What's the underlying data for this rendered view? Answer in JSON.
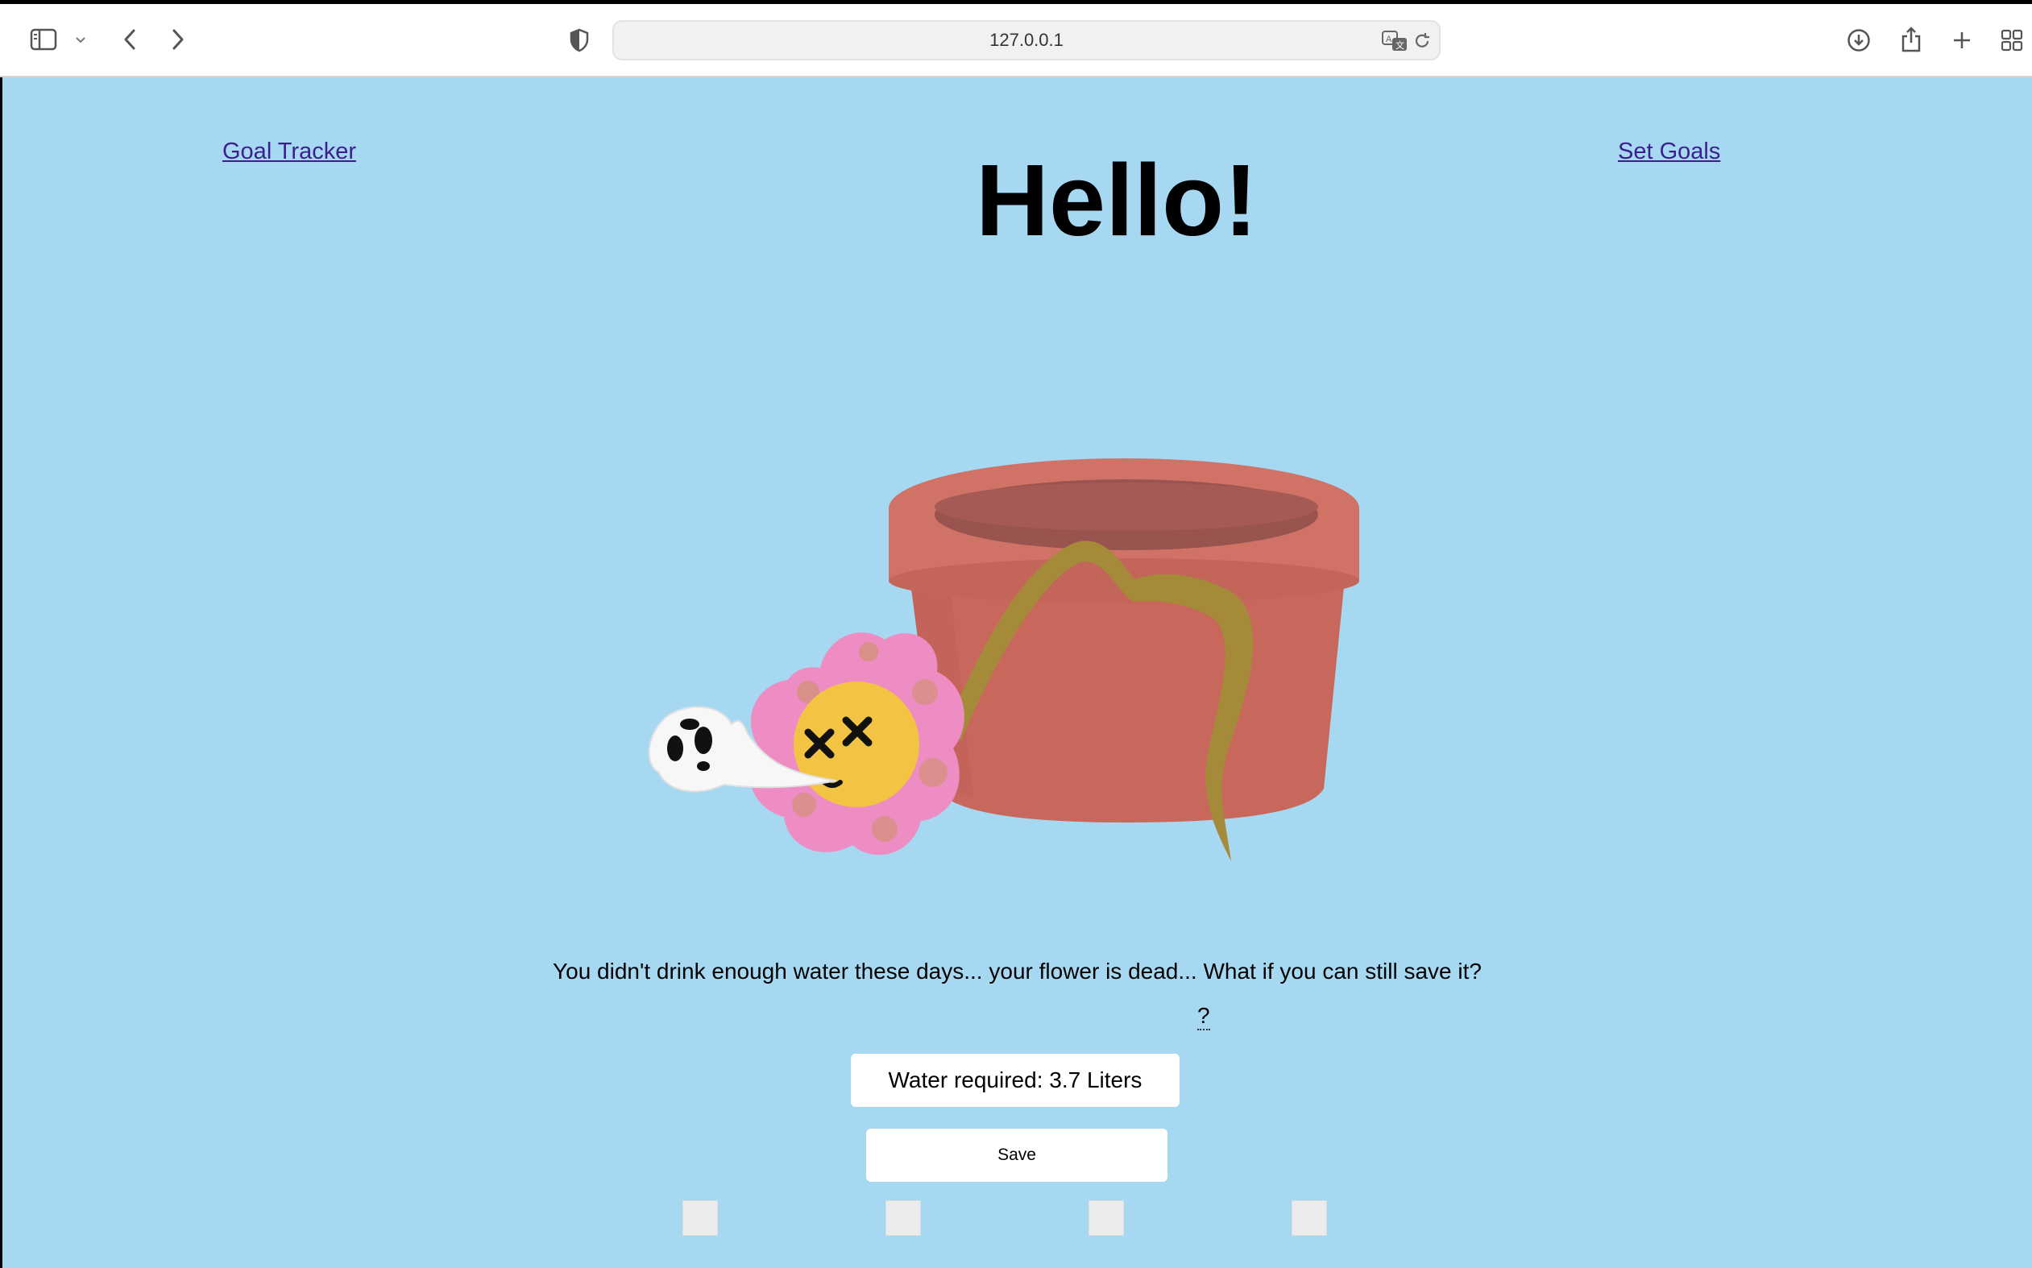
{
  "browser": {
    "url": "127.0.0.1",
    "icons": [
      "sidebar-icon",
      "chevron-down-icon",
      "back-icon",
      "forward-icon",
      "shield-icon",
      "translate-icon",
      "reload-icon",
      "download-icon",
      "share-icon",
      "new-tab-icon",
      "tab-overview-icon"
    ]
  },
  "nav": {
    "left_link": "Goal Tracker",
    "right_link": "Set Goals"
  },
  "header": {
    "title": "Hello!"
  },
  "illustration": {
    "subject": "dead flower with ghost beside a flower pot",
    "colors": {
      "pot": "#c8685c",
      "petals": "#ee8cc4",
      "face": "#f3c444",
      "stem": "#a58a3a"
    }
  },
  "main": {
    "message": "You didn't drink enough water these days... your flower is dead... What if you can still save it?",
    "help_marker": "?",
    "water_required": "Water required: 3.7 Liters",
    "save_label": "Save"
  },
  "colors": {
    "page_background": "#a7d8f2",
    "link": "#3b1f8e"
  }
}
